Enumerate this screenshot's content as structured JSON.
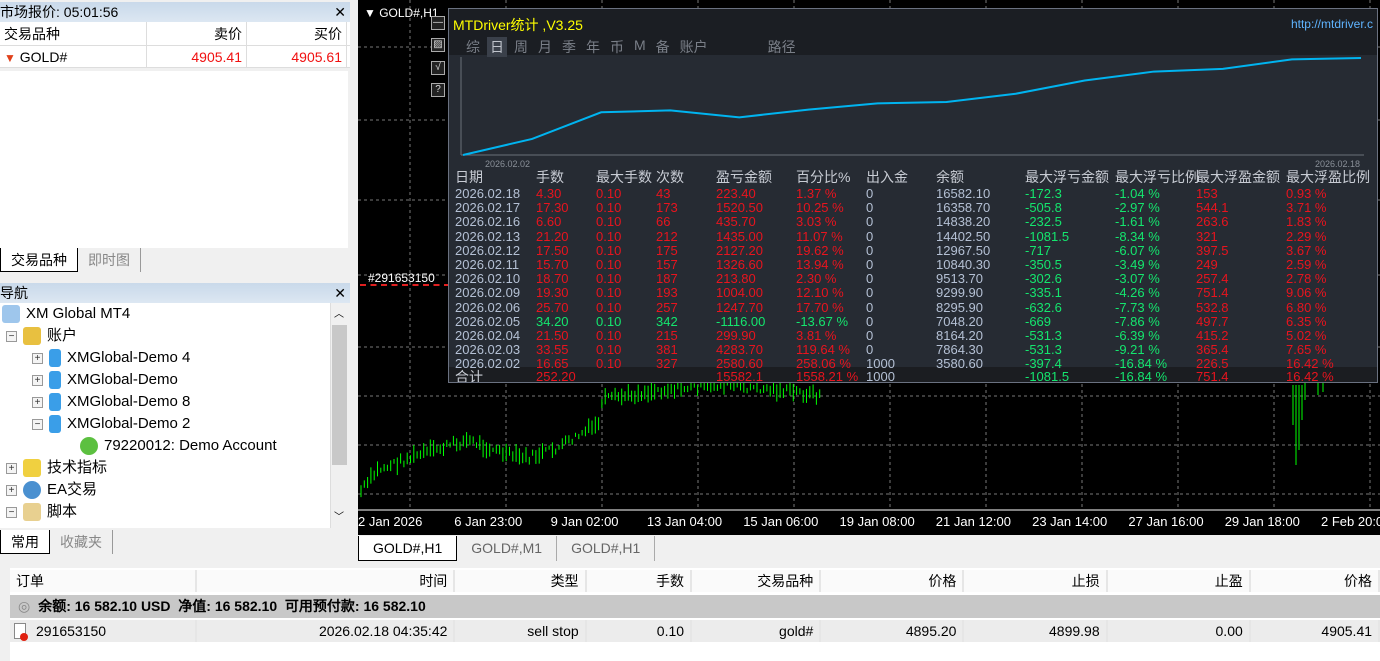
{
  "market_watch": {
    "title": "市场报价: 05:01:56",
    "columns": [
      "交易品种",
      "卖价",
      "买价"
    ],
    "rows": [
      {
        "symbol": "GOLD#",
        "bid": "4905.41",
        "ask": "4905.61",
        "direction": "down"
      }
    ],
    "tabs": [
      "交易品种",
      "即时图"
    ]
  },
  "navigator": {
    "title": "导航",
    "root": "XM Global MT4",
    "accounts_label": "账户",
    "servers": [
      "XMGlobal-Demo 4",
      "XMGlobal-Demo",
      "XMGlobal-Demo 8",
      "XMGlobal-Demo 2"
    ],
    "account": "79220012: Demo Account",
    "indicators": "技术指标",
    "experts": "EA交易",
    "scripts": "脚本",
    "tabs": [
      "常用",
      "收藏夹"
    ]
  },
  "chart": {
    "title": "GOLD#,H1",
    "order_label": "#291653150",
    "x_labels": [
      "2 Jan 2026",
      "6 Jan 23:00",
      "9 Jan 02:00",
      "13 Jan 04:00",
      "15 Jan 06:00",
      "19 Jan 08:00",
      "21 Jan 12:00",
      "23 Jan 14:00",
      "27 Jan 16:00",
      "29 Jan 18:00",
      "2 Feb 20:00"
    ],
    "tabs": [
      "GOLD#,H1",
      "GOLD#,M1",
      "GOLD#,H1"
    ],
    "bar_color": "#00ff00"
  },
  "stats_panel": {
    "title": "MTDriver统计 ,V3.25",
    "url": "http://mtdriver.c",
    "tabs": [
      "综",
      "日",
      "周",
      "月",
      "季",
      "年",
      "币",
      "M",
      "备",
      "账户",
      "路径"
    ],
    "active_tab": "日",
    "equity_start": "2026.02.02",
    "equity_end": "2026.02.18",
    "line_color": "#00b4f0",
    "columns": [
      "日期",
      "手数",
      "最大手数",
      "次数",
      "盈亏金额",
      "百分比%",
      "出入金",
      "余额",
      "最大浮亏金额",
      "最大浮亏比例",
      "最大浮盈金额",
      "最大浮盈比例"
    ],
    "rows": [
      [
        "2026.02.18",
        "4.30",
        "0.10",
        "43",
        "223.40",
        "1.37 %",
        "0",
        "16582.10",
        "-172.3",
        "-1.04 %",
        "153",
        "0.93 %"
      ],
      [
        "2026.02.17",
        "17.30",
        "0.10",
        "173",
        "1520.50",
        "10.25 %",
        "0",
        "16358.70",
        "-505.8",
        "-2.97 %",
        "544.1",
        "3.71 %"
      ],
      [
        "2026.02.16",
        "6.60",
        "0.10",
        "66",
        "435.70",
        "3.03 %",
        "0",
        "14838.20",
        "-232.5",
        "-1.61 %",
        "263.6",
        "1.83 %"
      ],
      [
        "2026.02.13",
        "21.20",
        "0.10",
        "212",
        "1435.00",
        "11.07 %",
        "0",
        "14402.50",
        "-1081.5",
        "-8.34 %",
        "321",
        "2.29 %"
      ],
      [
        "2026.02.12",
        "17.50",
        "0.10",
        "175",
        "2127.20",
        "19.62 %",
        "0",
        "12967.50",
        "-717",
        "-6.07 %",
        "397.5",
        "3.67 %"
      ],
      [
        "2026.02.11",
        "15.70",
        "0.10",
        "157",
        "1326.60",
        "13.94 %",
        "0",
        "10840.30",
        "-350.5",
        "-3.49 %",
        "249",
        "2.59 %"
      ],
      [
        "2026.02.10",
        "18.70",
        "0.10",
        "187",
        "213.80",
        "2.30 %",
        "0",
        "9513.70",
        "-302.6",
        "-3.07 %",
        "257.4",
        "2.78 %"
      ],
      [
        "2026.02.09",
        "19.30",
        "0.10",
        "193",
        "1004.00",
        "12.10 %",
        "0",
        "9299.90",
        "-335.1",
        "-4.26 %",
        "751.4",
        "9.06 %"
      ],
      [
        "2026.02.06",
        "25.70",
        "0.10",
        "257",
        "1247.70",
        "17.70 %",
        "0",
        "8295.90",
        "-632.6",
        "-7.73 %",
        "532.8",
        "6.80 %"
      ],
      [
        "2026.02.05",
        "34.20",
        "0.10",
        "342",
        "-1116.00",
        "-13.67 %",
        "0",
        "7048.20",
        "-669",
        "-7.86 %",
        "497.7",
        "6.35 %"
      ],
      [
        "2026.02.04",
        "21.50",
        "0.10",
        "215",
        "299.90",
        "3.81 %",
        "0",
        "8164.20",
        "-531.3",
        "-6.39 %",
        "415.2",
        "5.02 %"
      ],
      [
        "2026.02.03",
        "33.55",
        "0.10",
        "381",
        "4283.70",
        "119.64 %",
        "0",
        "7864.30",
        "-531.3",
        "-9.21 %",
        "365.4",
        "7.65 %"
      ],
      [
        "2026.02.02",
        "16.65",
        "0.10",
        "327",
        "2580.60",
        "258.06 %",
        "1000",
        "3580.60",
        "-397.4",
        "-16.84 %",
        "226.5",
        "16.42 %"
      ]
    ],
    "total": [
      "合计",
      "252.20",
      "",
      "",
      "15582.1",
      "1558.21 %",
      "1000",
      "",
      "-1081.5",
      "-16.84 %",
      "751.4",
      "16.42 %"
    ],
    "colors": {
      "profit": "#e8141e",
      "loss": "#14e66e",
      "text": "#b4c0d4",
      "background": "#262b33"
    }
  },
  "terminal": {
    "columns": [
      "订单",
      "时间",
      "类型",
      "手数",
      "交易品种",
      "价格",
      "止损",
      "止盈",
      "价格"
    ],
    "summary": "余额: 16 582.10 USD  净值: 16 582.10  可用预付款: 16 582.10",
    "orders": [
      [
        "291653150",
        "2026.02.18 04:35:42",
        "sell stop",
        "0.10",
        "gold#",
        "4895.20",
        "4899.98",
        "0.00",
        "4905.41"
      ]
    ]
  }
}
